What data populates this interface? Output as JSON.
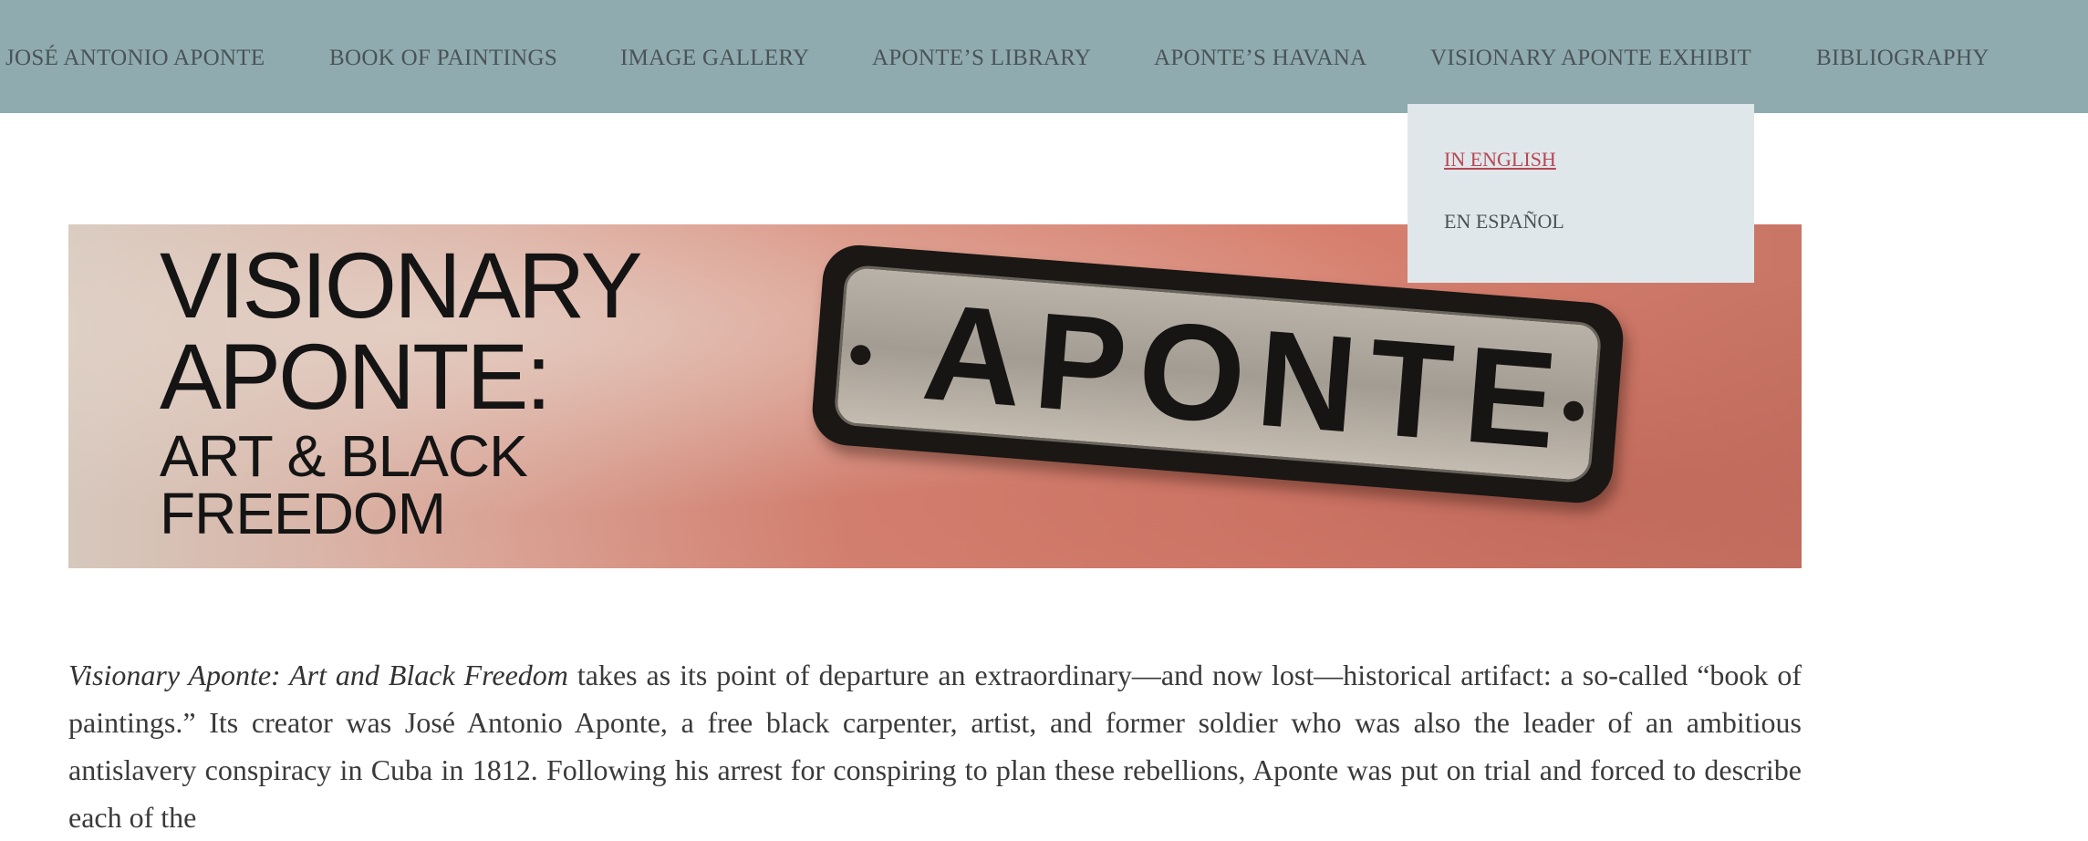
{
  "nav": {
    "items": [
      {
        "label": "JOSÉ ANTONIO APONTE"
      },
      {
        "label": "BOOK OF PAINTINGS"
      },
      {
        "label": "IMAGE GALLERY"
      },
      {
        "label": "APONTE’S LIBRARY"
      },
      {
        "label": "APONTE’S HAVANA"
      },
      {
        "label": "VISIONARY APONTE EXHIBIT"
      },
      {
        "label": "BIBLIOGRAPHY"
      }
    ],
    "dropdown": [
      {
        "label": "IN ENGLISH"
      },
      {
        "label": "EN ESPAÑOL"
      }
    ]
  },
  "hero": {
    "line1": "VISIONARY",
    "line2": "APONTE:",
    "line3": "ART & BLACK",
    "line4": "FREEDOM",
    "sign_text": "APONTE"
  },
  "article": {
    "title_italic": "Visionary Aponte: Art and Black Freedom",
    "text": " takes as its point of departure an extraordinary—and now lost—historical artifact: a so-called “book of paintings.” Its creator was José Antonio Aponte, a free black carpenter, artist, and former soldier who was also the leader of an ambitious antislavery conspiracy in Cuba in 1812. Following his arrest for conspiring to plan these rebellions, Aponte was put on trial and forced to describe each of the"
  },
  "colors": {
    "nav_bg": "#8fabb0",
    "dropdown_bg": "#e0e7ea",
    "active_link": "#b84553"
  }
}
